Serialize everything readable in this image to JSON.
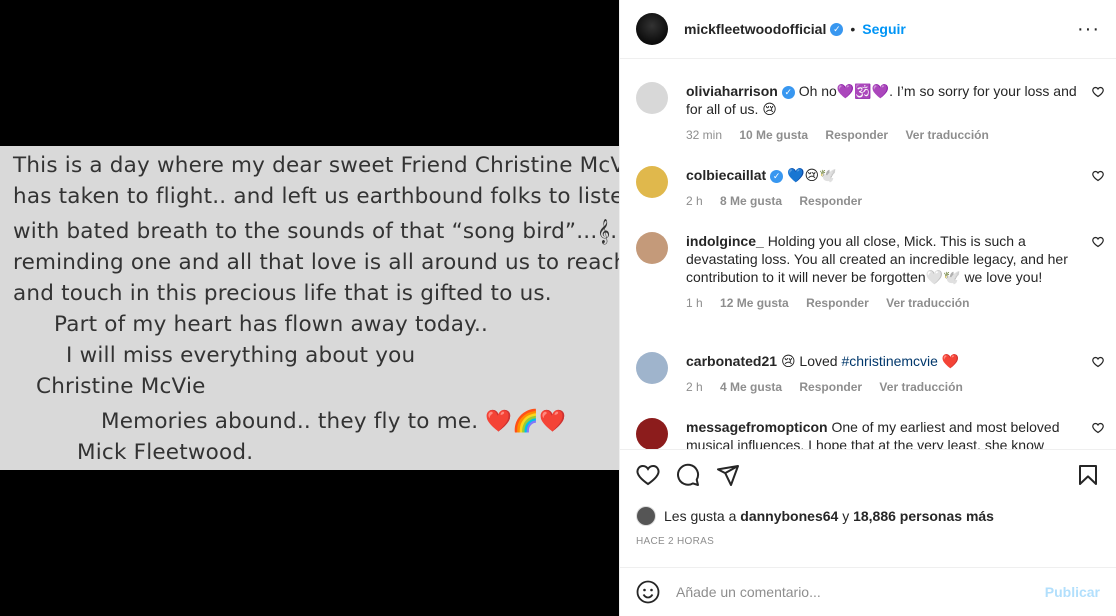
{
  "image": {
    "lines": [
      "This is a day where my dear sweet Friend Christine McVie",
      "has taken to flight.. and left us earthbound folks to listen",
      "with bated breath to the sounds of that “song bird”...𝄞..",
      "reminding one and all that love is all around us to reach for",
      "and touch in this precious life that is gifted to us.",
      "Part of my heart has flown away today..",
      "I will miss everything about you",
      "Christine McVie",
      "Memories abound.. they fly to me. ❤️🌈❤️",
      "Mick Fleetwood."
    ]
  },
  "header": {
    "username": "mickfleetwoodofficial",
    "verified_mark": "✓",
    "separator": "•",
    "follow_label": "Seguir",
    "more_label": "···"
  },
  "comments": [
    {
      "user": "oliviaharrison",
      "verified": true,
      "text": "Oh no💜🕉️💜. I’m so sorry for your loss and for all of us. 😢",
      "time": "32 min",
      "likes": "10 Me gusta",
      "reply": "Responder",
      "translate": "Ver traducción",
      "avatar_color": "#3a3a3a"
    },
    {
      "user": "colbiecaillat",
      "verified": true,
      "text": "💙😢🕊️",
      "time": "2 h",
      "likes": "8 Me gusta",
      "reply": "Responder",
      "translate": "",
      "avatar_color": "#c9a24a"
    },
    {
      "user": "indolgince_",
      "verified": false,
      "text": "Holding you all close, Mick. This is such a devastating loss. You all created an incredible legacy, and her contribution to it will never be forgotten🤍🕊️ we love you!",
      "time": "1 h",
      "likes": "12 Me gusta",
      "reply": "Responder",
      "translate": "Ver traducción",
      "avatar_color": "#b78a6a"
    },
    {
      "user": "carbonated21",
      "verified": false,
      "text_pre": "😢 Loved",
      "tag": "#christinemcvie",
      "text_post": "❤️",
      "time": "2 h",
      "likes": "4 Me gusta",
      "reply": "Responder",
      "translate": "Ver traducción",
      "avatar_color": "#8aa3c2"
    },
    {
      "user": "messagefromopticon",
      "verified": false,
      "text": "One of my earliest and most beloved musical influences. I hope that at the very least, she know",
      "avatar_color": "#9b2226"
    }
  ],
  "likes": {
    "prefix": "Les gusta a",
    "user": "dannybones64",
    "conj": "y",
    "others": "18,886 personas más"
  },
  "timestamp": "HACE 2 HORAS",
  "add_comment": {
    "placeholder": "Añade un comentario...",
    "post_label": "Publicar"
  }
}
